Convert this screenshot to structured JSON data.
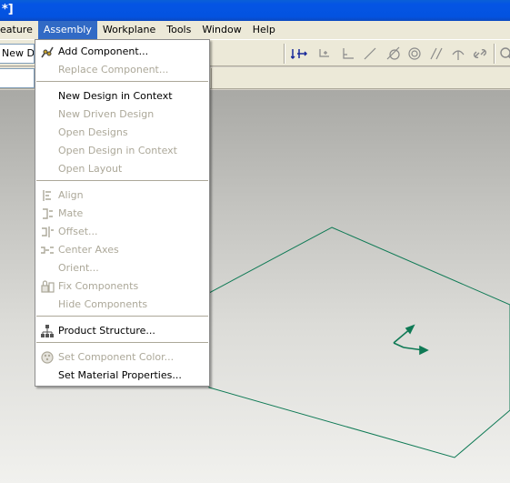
{
  "window": {
    "title": "*]"
  },
  "menubar": {
    "items": [
      {
        "label": "eature"
      },
      {
        "label": "Assembly"
      },
      {
        "label": "Workplane"
      },
      {
        "label": "Tools"
      },
      {
        "label": "Window"
      },
      {
        "label": "Help"
      }
    ]
  },
  "toolbar": {
    "design_input": "New De",
    "icons": [
      "xyz-axes-icon",
      "move-icon",
      "angle-icon",
      "line-icon",
      "tangent-circle-icon",
      "concentric-icon",
      "parallel-icon",
      "sketch-point-icon",
      "link-icon",
      "zoom-icon"
    ]
  },
  "assembly_menu": {
    "items": [
      {
        "label": "Add Component...",
        "icon": "add-component-icon",
        "enabled": true
      },
      {
        "label": "Replace Component...",
        "enabled": false
      },
      {
        "label": "New Design in Context",
        "enabled": true
      },
      {
        "label": "New Driven Design",
        "enabled": false
      },
      {
        "label": "Open Designs",
        "enabled": false
      },
      {
        "label": "Open Design in Context",
        "enabled": false
      },
      {
        "label": "Open Layout",
        "enabled": false
      },
      {
        "label": "Align",
        "icon": "align-icon",
        "enabled": false
      },
      {
        "label": "Mate",
        "icon": "mate-icon",
        "enabled": false
      },
      {
        "label": "Offset...",
        "icon": "offset-icon",
        "enabled": false
      },
      {
        "label": "Center Axes",
        "icon": "center-axes-icon",
        "enabled": false
      },
      {
        "label": "Orient...",
        "enabled": false
      },
      {
        "label": "Fix Components",
        "icon": "fix-components-icon",
        "enabled": false
      },
      {
        "label": "Hide Components",
        "enabled": false
      },
      {
        "label": "Product Structure...",
        "icon": "product-structure-icon",
        "enabled": true
      },
      {
        "label": "Set Component Color...",
        "icon": "color-icon",
        "enabled": false
      },
      {
        "label": "Set Material Properties...",
        "enabled": true
      }
    ]
  },
  "colors": {
    "titlebar": "#0454e4",
    "menu_highlight": "#316ac5",
    "workplane": "#0f7a55",
    "triad": "#0f7a55"
  }
}
